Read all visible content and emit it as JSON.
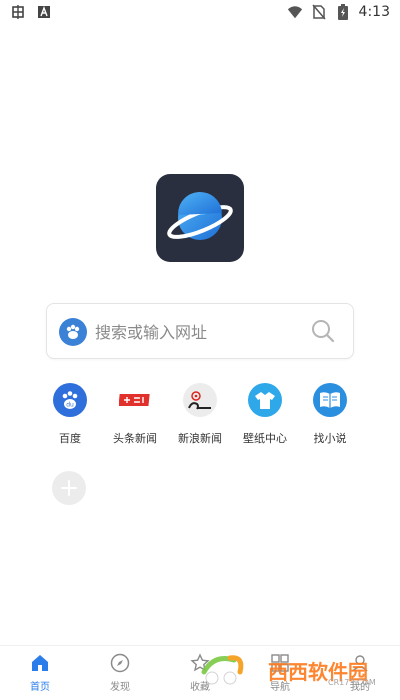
{
  "status_bar": {
    "time": "4:13",
    "left_icons": [
      "bug-icon",
      "font-icon"
    ],
    "right_icons": [
      "wifi-icon",
      "no-sim-icon",
      "battery-icon"
    ]
  },
  "search": {
    "placeholder": "搜索或输入网址",
    "engine_icon": "baidu-paw-icon"
  },
  "shortcuts": [
    {
      "label": "百度",
      "icon": "baidu-icon",
      "color": "#2e6fdc"
    },
    {
      "label": "头条新闻",
      "icon": "toutiao-icon",
      "color": "#e0312d"
    },
    {
      "label": "新浪新闻",
      "icon": "sina-icon",
      "color": "#e8e8e8"
    },
    {
      "label": "壁纸中心",
      "icon": "shirt-icon",
      "color": "#2ea8e8"
    },
    {
      "label": "找小说",
      "icon": "book-icon",
      "color": "#2b8fe0"
    }
  ],
  "bottom_nav": [
    {
      "label": "首页",
      "icon": "home-icon",
      "active": true
    },
    {
      "label": "发现",
      "icon": "compass-icon",
      "active": false
    },
    {
      "label": "收藏",
      "icon": "star-icon",
      "active": false
    },
    {
      "label": "导航",
      "icon": "nav-icon",
      "active": false
    },
    {
      "label": "我的",
      "icon": "user-icon",
      "active": false
    }
  ],
  "watermark": {
    "text": "西西软件园",
    "sub": "CR173.COM"
  },
  "colors": {
    "accent": "#2b7de9",
    "logo_bg": "#2a2f40"
  }
}
